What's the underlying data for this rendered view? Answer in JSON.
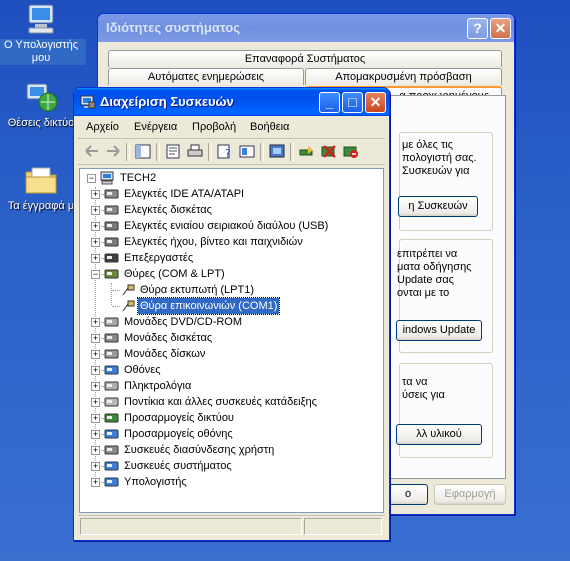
{
  "desktop": {
    "icons": [
      {
        "label": "Ο Υπολογιστής μου"
      },
      {
        "label": "Θέσεις δικτύο"
      },
      {
        "label": "Τα έγγραφά μ"
      }
    ]
  },
  "system_properties": {
    "title": "Ιδιότητες συστήματος",
    "tabs_row1": [
      "Επαναφορά Συστήματος"
    ],
    "tabs_row2": [
      "Αυτόματες ενημερώσεις",
      "Απομακρυσμένη πρόσβαση"
    ],
    "tabs_row3_visible": "α προχωρημένους",
    "group1_text": "με όλες τις\nπολογιστή σας.\nΣυσκευών για",
    "group1_button": "η Συσκευών",
    "group2_text": "επιτρέπει να\nματα οδήγησης\nUpdate σας\nονται με το",
    "group2_button": "indows Update",
    "group3_text": "τα να\nύσεις για",
    "group3_button": "λλ υλικού",
    "ok_button": "ο",
    "apply_button": "Εφαρμογή"
  },
  "device_manager": {
    "title": "Διαχείριση Συσκευών",
    "menu": [
      "Αρχείο",
      "Ενέργεια",
      "Προβολή",
      "Βοήθεια"
    ],
    "root": "TECH2",
    "nodes": [
      {
        "label": "Ελεγκτές IDE ATA/ATAPI",
        "icon": "ide-controller-icon",
        "expanded": false
      },
      {
        "label": "Ελεγκτές δισκέτας",
        "icon": "floppy-controller-icon",
        "expanded": false
      },
      {
        "label": "Ελεγκτές ενιαίου σειριακού διαύλου (USB)",
        "icon": "usb-icon",
        "expanded": false
      },
      {
        "label": "Ελεγκτές ήχου, βίντεο και παιχνιδιών",
        "icon": "sound-icon",
        "expanded": false
      },
      {
        "label": "Επεξεργαστές",
        "icon": "processor-icon",
        "expanded": false
      },
      {
        "label": "Θύρες (COM & LPT)",
        "icon": "port-icon",
        "expanded": true
      },
      {
        "label": "Μονάδες DVD/CD-ROM",
        "icon": "cdrom-icon",
        "expanded": false
      },
      {
        "label": "Μονάδες δισκέτας",
        "icon": "floppy-drive-icon",
        "expanded": false
      },
      {
        "label": "Μονάδες δίσκων",
        "icon": "disk-drive-icon",
        "expanded": false
      },
      {
        "label": "Οθόνες",
        "icon": "monitor-icon",
        "expanded": false
      },
      {
        "label": "Πληκτρολόγια",
        "icon": "keyboard-icon",
        "expanded": false
      },
      {
        "label": "Ποντίκια και άλλες συσκευές κατάδειξης",
        "icon": "mouse-icon",
        "expanded": false
      },
      {
        "label": "Προσαρμογείς δικτύου",
        "icon": "network-adapter-icon",
        "expanded": false
      },
      {
        "label": "Προσαρμογείς οθόνης",
        "icon": "display-adapter-icon",
        "expanded": false
      },
      {
        "label": "Συσκευές διασύνδεσης χρήστη",
        "icon": "hid-icon",
        "expanded": false
      },
      {
        "label": "Συσκευές συστήματος",
        "icon": "system-device-icon",
        "expanded": false
      },
      {
        "label": "Υπολογιστής",
        "icon": "computer-icon",
        "expanded": false
      }
    ],
    "port_children": [
      {
        "label": "Θύρα εκτυπωτή (LPT1)",
        "selected": false
      },
      {
        "label": "Θύρα επικοινωνιών (COM1)",
        "selected": true
      }
    ]
  }
}
